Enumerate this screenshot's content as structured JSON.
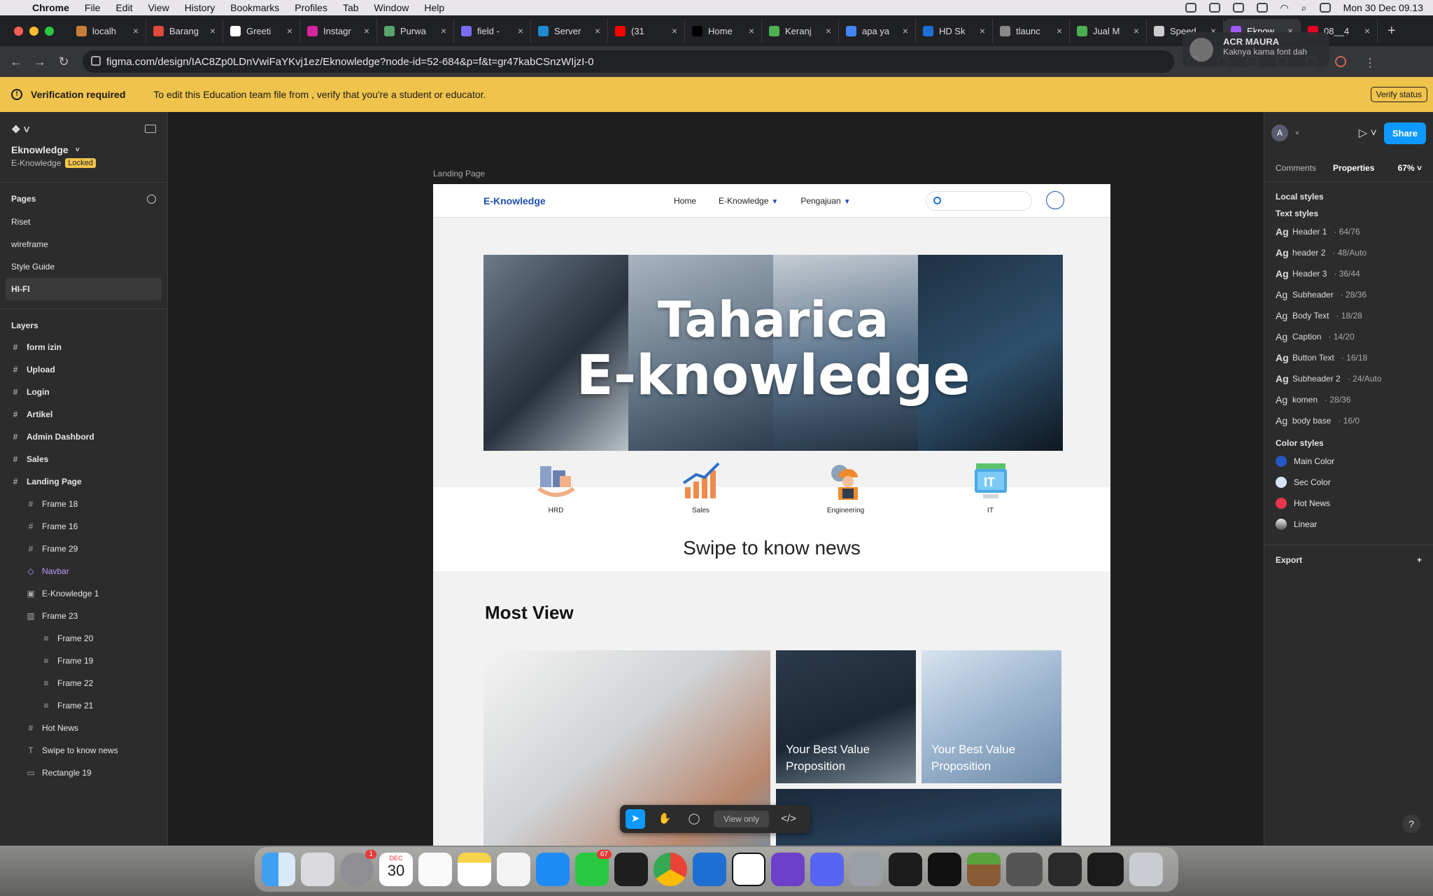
{
  "menubar": {
    "app": "Chrome",
    "items": [
      "File",
      "Edit",
      "View",
      "History",
      "Bookmarks",
      "Profiles",
      "Tab",
      "Window",
      "Help"
    ],
    "datetime": "Mon 30 Dec  09.13"
  },
  "tabs": [
    {
      "label": "localh",
      "color": "#c77d3a"
    },
    {
      "label": "Barang",
      "color": "#e24a3b"
    },
    {
      "label": "Greeti",
      "color": "#ffffff"
    },
    {
      "label": "Instagr",
      "color": "#d6249f"
    },
    {
      "label": "Purwa",
      "color": "#5aa469"
    },
    {
      "label": "field -",
      "color": "#7b6cf6"
    },
    {
      "label": "Server",
      "color": "#1f8ad2"
    },
    {
      "label": "(31",
      "color": "#ff0000"
    },
    {
      "label": "Home",
      "color": "#000000"
    },
    {
      "label": "Keranj",
      "color": "#4caf50"
    },
    {
      "label": "apa ya",
      "color": "#4285f4"
    },
    {
      "label": "HD Sk",
      "color": "#1d6fd8"
    },
    {
      "label": "tlaunc",
      "color": "#888888"
    },
    {
      "label": "Jual M",
      "color": "#4caf50"
    },
    {
      "label": "Speed",
      "color": "#cccccc"
    },
    {
      "label": "Eknow",
      "color": "#a259ff"
    },
    {
      "label": "08__4",
      "color": "#e60023"
    }
  ],
  "address": {
    "url": "figma.com/design/IAC8Zp0LDnVwiFaYKvj1ez/Eknowledge?node-id=52-684&p=f&t=gr47kabCSnzWIjzI-0"
  },
  "notification": {
    "title": "ACR MAURA",
    "body": "Kaknya karna font dah"
  },
  "banner": {
    "title": "Verification required",
    "message": "To edit this Education team file from , verify that you're a student or educator.",
    "button": "Verify status",
    "color": "#f0c44c"
  },
  "left_panel": {
    "file_name": "Eknowledge",
    "project": "E-Knowledge",
    "locked": "Locked",
    "pages_title": "Pages",
    "pages": [
      "Riset",
      "wireframe",
      "Style Guide",
      "HI-FI"
    ],
    "selected_page": "HI-FI",
    "layers_title": "Layers",
    "layers": [
      {
        "name": "form izin",
        "depth": 0,
        "bold": true,
        "icon": "#"
      },
      {
        "name": "Upload",
        "depth": 0,
        "bold": true,
        "icon": "#"
      },
      {
        "name": "Login",
        "depth": 0,
        "bold": true,
        "icon": "#"
      },
      {
        "name": "Artikel",
        "depth": 0,
        "bold": true,
        "icon": "#"
      },
      {
        "name": "Admin Dashbord",
        "depth": 0,
        "bold": true,
        "icon": "#"
      },
      {
        "name": "Sales",
        "depth": 0,
        "bold": true,
        "icon": "#"
      },
      {
        "name": "Landing Page",
        "depth": 0,
        "bold": true,
        "icon": "#"
      },
      {
        "name": "Frame 18",
        "depth": 1,
        "bold": false,
        "icon": "#"
      },
      {
        "name": "Frame 16",
        "depth": 1,
        "bold": false,
        "icon": "#"
      },
      {
        "name": "Frame 29",
        "depth": 1,
        "bold": false,
        "icon": "#"
      },
      {
        "name": "Navbar",
        "depth": 1,
        "bold": false,
        "icon": "◇",
        "component": true
      },
      {
        "name": "E-Knowledge 1",
        "depth": 1,
        "bold": false,
        "icon": "▣"
      },
      {
        "name": "Frame 23",
        "depth": 1,
        "bold": false,
        "icon": "▥"
      },
      {
        "name": "Frame 20",
        "depth": 2,
        "bold": false,
        "icon": "≡"
      },
      {
        "name": "Frame 19",
        "depth": 2,
        "bold": false,
        "icon": "≡"
      },
      {
        "name": "Frame 22",
        "depth": 2,
        "bold": false,
        "icon": "≡"
      },
      {
        "name": "Frame 21",
        "depth": 2,
        "bold": false,
        "icon": "≡"
      },
      {
        "name": "Hot News",
        "depth": 1,
        "bold": false,
        "icon": "#"
      },
      {
        "name": "Swipe to know news",
        "depth": 1,
        "bold": false,
        "icon": "T"
      },
      {
        "name": "Rectangle 19",
        "depth": 1,
        "bold": false,
        "icon": "▭"
      }
    ]
  },
  "right_panel": {
    "avatar": "A",
    "share": "Share",
    "tabs": [
      "Comments",
      "Properties"
    ],
    "active_tab": "Properties",
    "zoom": "67%",
    "local_styles": "Local styles",
    "text_styles_title": "Text styles",
    "text_styles": [
      {
        "name": "Header 1",
        "meta": " · 64/76",
        "weight": "bold"
      },
      {
        "name": "header 2",
        "meta": " · 48/Auto",
        "weight": "bold"
      },
      {
        "name": "Header 3",
        "meta": " · 36/44",
        "weight": "bold"
      },
      {
        "name": "Subheader",
        "meta": " · 28/36",
        "weight": "normal"
      },
      {
        "name": "Body Text",
        "meta": " · 18/28",
        "weight": "normal"
      },
      {
        "name": "Caption",
        "meta": " · 14/20",
        "weight": "normal"
      },
      {
        "name": "Button Text",
        "meta": " · 16/18",
        "weight": "bold"
      },
      {
        "name": "Subheader 2",
        "meta": " · 24/Auto",
        "weight": "bold"
      },
      {
        "name": "komen",
        "meta": " · 28/36",
        "weight": "normal"
      },
      {
        "name": "body base",
        "meta": " · 16/0",
        "weight": "normal"
      }
    ],
    "color_styles_title": "Color styles",
    "color_styles": [
      {
        "name": "Main Color",
        "color": "#2456c4"
      },
      {
        "name": "Sec Color",
        "color": "#d6e4f7"
      },
      {
        "name": "Hot News",
        "color": "#e8374d"
      },
      {
        "name": "Linear",
        "color": "#888888"
      }
    ],
    "export": "Export"
  },
  "canvas": {
    "frame_label": "Landing Page",
    "site": {
      "logo": "E-Knowledge",
      "nav": [
        "Home",
        "E-Knowledge",
        "Pengajuan"
      ],
      "hero_title_1": "Taharica",
      "hero_title_2": "E-knowledge",
      "categories": [
        {
          "label": "HRD",
          "icon": "hrd-icon"
        },
        {
          "label": "Sales",
          "icon": "sales-chart-icon"
        },
        {
          "label": "Engineering",
          "icon": "engineer-icon"
        },
        {
          "label": "IT",
          "icon": "it-monitor-icon"
        }
      ],
      "swipe": "Swipe to know news",
      "most_view": "Most View",
      "cards": [
        {
          "caption": ""
        },
        {
          "caption": "Your Best Value Proposition"
        },
        {
          "caption": "Your Best Value Proposition"
        },
        {
          "caption": ""
        }
      ]
    }
  },
  "toolbar": {
    "view_only": "View only"
  },
  "dock": {
    "calendar_month": "DEC",
    "calendar_day": "30",
    "settings_badge": "1",
    "whatsapp_badge": "67"
  }
}
